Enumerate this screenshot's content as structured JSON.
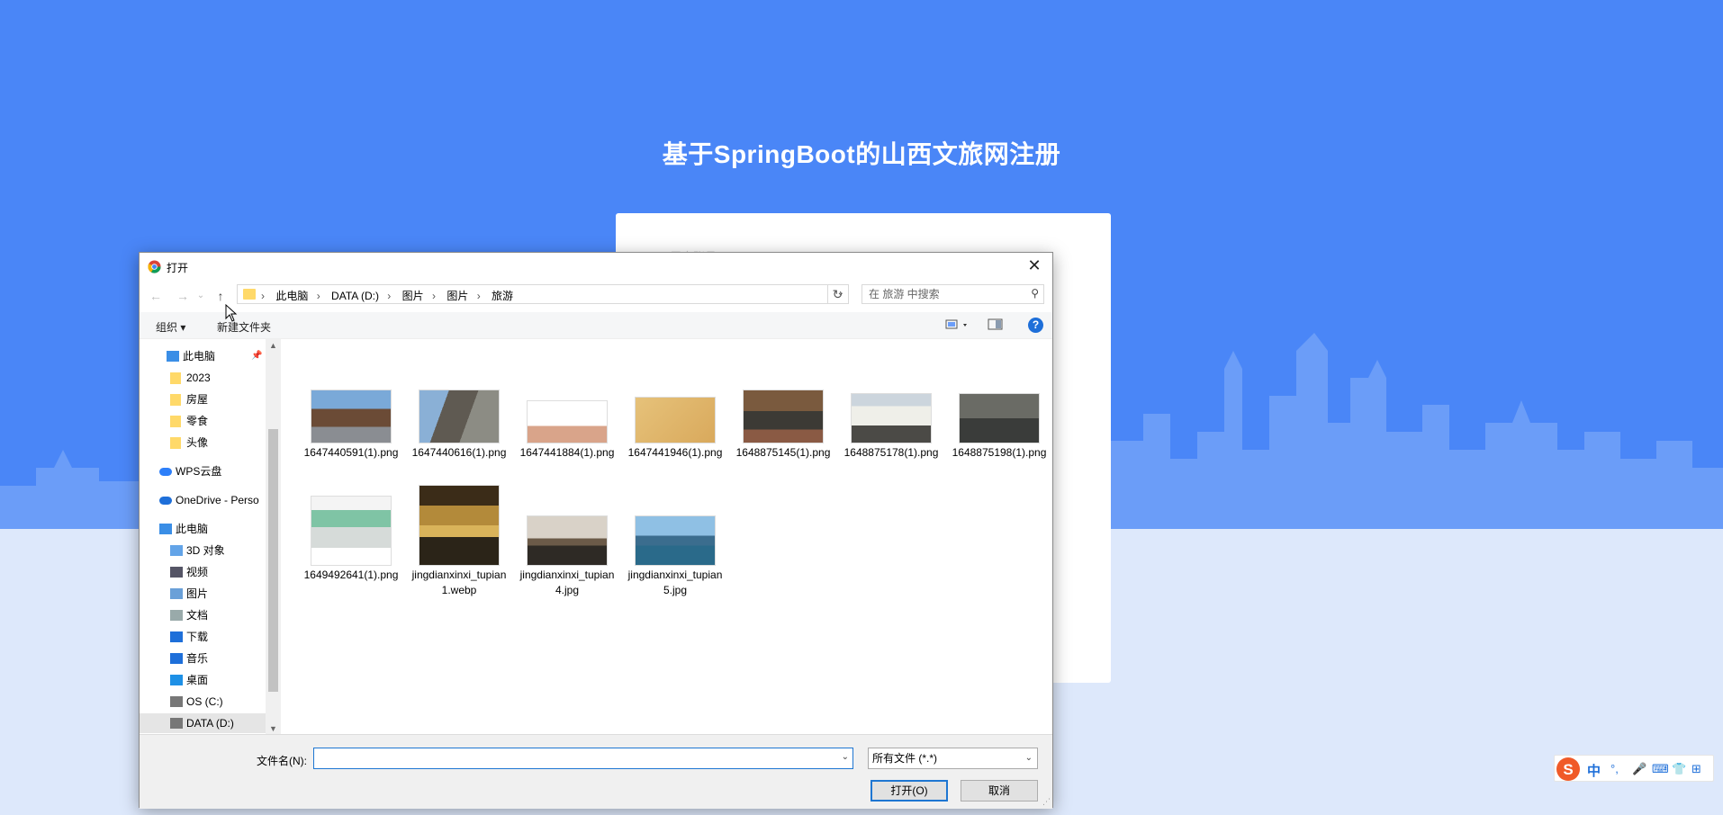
{
  "page": {
    "title": "基于SpringBoot的山西文旅网注册",
    "card_hint": "用户账号："
  },
  "dialog": {
    "title": "打开",
    "close_glyph": "✕",
    "nav": {
      "back": "←",
      "forward": "→",
      "recent": "⌄",
      "up": "↑"
    },
    "breadcrumb": [
      "此电脑",
      "DATA (D:)",
      "图片",
      "图片",
      "旅游"
    ],
    "search_placeholder": "在 旅游 中搜索",
    "toolbar": {
      "organize": "组织 ▾",
      "new_folder": "新建文件夹",
      "help": "?"
    },
    "sidebar": [
      {
        "label": "此电脑",
        "icon": "computer-icon",
        "pinned": true
      },
      {
        "label": "2023",
        "icon": "folder-icon"
      },
      {
        "label": "房屋",
        "icon": "folder-icon"
      },
      {
        "label": "零食",
        "icon": "folder-icon"
      },
      {
        "label": "头像",
        "icon": "folder-icon"
      },
      {
        "label": "WPS云盘",
        "icon": "cloud-icon"
      },
      {
        "label": "OneDrive - Perso",
        "icon": "onedrive-icon"
      },
      {
        "label": "此电脑",
        "icon": "computer-icon"
      },
      {
        "label": "3D 对象",
        "icon": "3d-objects-icon"
      },
      {
        "label": "视频",
        "icon": "video-icon"
      },
      {
        "label": "图片",
        "icon": "pictures-icon"
      },
      {
        "label": "文档",
        "icon": "documents-icon"
      },
      {
        "label": "下载",
        "icon": "download-icon"
      },
      {
        "label": "音乐",
        "icon": "music-icon"
      },
      {
        "label": "桌面",
        "icon": "desktop-icon"
      },
      {
        "label": "OS (C:)",
        "icon": "drive-icon"
      },
      {
        "label": "DATA (D:)",
        "icon": "drive-icon",
        "selected": true
      }
    ],
    "files": [
      {
        "name": "1647440591(1).png"
      },
      {
        "name": "1647440616(1).png"
      },
      {
        "name": "1647441884(1).png"
      },
      {
        "name": "1647441946(1).png"
      },
      {
        "name": "1648875145(1).png"
      },
      {
        "name": "1648875178(1).png"
      },
      {
        "name": "1648875198(1).png"
      },
      {
        "name": "1649492641(1).png"
      },
      {
        "name": "jingdianxinxi_tupian1.webp"
      },
      {
        "name": "jingdianxinxi_tupian4.jpg"
      },
      {
        "name": "jingdianxinxi_tupian5.jpg"
      }
    ],
    "filename_label": "文件名(N):",
    "filename_value": "",
    "filetype": "所有文件 (*.*)",
    "open_button": "打开(O)",
    "cancel_button": "取消"
  },
  "ime": {
    "lang": "中",
    "punct": "°,",
    "mic": "🎤",
    "keyboard": "⌨",
    "skin": "👕",
    "tools": "⊞"
  },
  "colors": {
    "background": "#4a86f7",
    "accent": "#1e76d2"
  }
}
